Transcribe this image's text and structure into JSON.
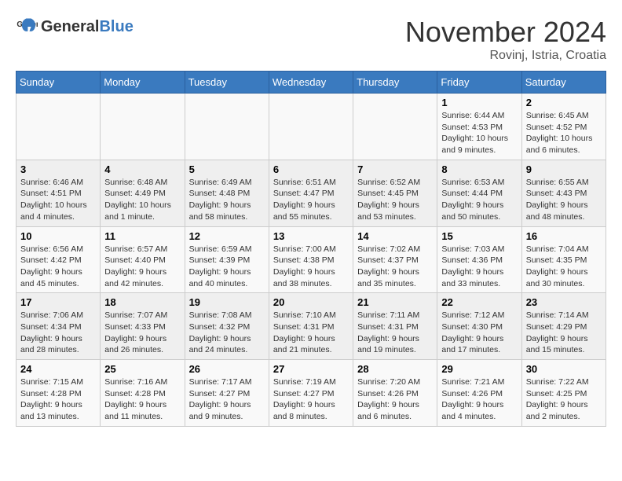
{
  "header": {
    "logo_general": "General",
    "logo_blue": "Blue",
    "month_year": "November 2024",
    "location": "Rovinj, Istria, Croatia"
  },
  "weekdays": [
    "Sunday",
    "Monday",
    "Tuesday",
    "Wednesday",
    "Thursday",
    "Friday",
    "Saturday"
  ],
  "weeks": [
    [
      {
        "day": "",
        "info": ""
      },
      {
        "day": "",
        "info": ""
      },
      {
        "day": "",
        "info": ""
      },
      {
        "day": "",
        "info": ""
      },
      {
        "day": "",
        "info": ""
      },
      {
        "day": "1",
        "info": "Sunrise: 6:44 AM\nSunset: 4:53 PM\nDaylight: 10 hours and 9 minutes."
      },
      {
        "day": "2",
        "info": "Sunrise: 6:45 AM\nSunset: 4:52 PM\nDaylight: 10 hours and 6 minutes."
      }
    ],
    [
      {
        "day": "3",
        "info": "Sunrise: 6:46 AM\nSunset: 4:51 PM\nDaylight: 10 hours and 4 minutes."
      },
      {
        "day": "4",
        "info": "Sunrise: 6:48 AM\nSunset: 4:49 PM\nDaylight: 10 hours and 1 minute."
      },
      {
        "day": "5",
        "info": "Sunrise: 6:49 AM\nSunset: 4:48 PM\nDaylight: 9 hours and 58 minutes."
      },
      {
        "day": "6",
        "info": "Sunrise: 6:51 AM\nSunset: 4:47 PM\nDaylight: 9 hours and 55 minutes."
      },
      {
        "day": "7",
        "info": "Sunrise: 6:52 AM\nSunset: 4:45 PM\nDaylight: 9 hours and 53 minutes."
      },
      {
        "day": "8",
        "info": "Sunrise: 6:53 AM\nSunset: 4:44 PM\nDaylight: 9 hours and 50 minutes."
      },
      {
        "day": "9",
        "info": "Sunrise: 6:55 AM\nSunset: 4:43 PM\nDaylight: 9 hours and 48 minutes."
      }
    ],
    [
      {
        "day": "10",
        "info": "Sunrise: 6:56 AM\nSunset: 4:42 PM\nDaylight: 9 hours and 45 minutes."
      },
      {
        "day": "11",
        "info": "Sunrise: 6:57 AM\nSunset: 4:40 PM\nDaylight: 9 hours and 42 minutes."
      },
      {
        "day": "12",
        "info": "Sunrise: 6:59 AM\nSunset: 4:39 PM\nDaylight: 9 hours and 40 minutes."
      },
      {
        "day": "13",
        "info": "Sunrise: 7:00 AM\nSunset: 4:38 PM\nDaylight: 9 hours and 38 minutes."
      },
      {
        "day": "14",
        "info": "Sunrise: 7:02 AM\nSunset: 4:37 PM\nDaylight: 9 hours and 35 minutes."
      },
      {
        "day": "15",
        "info": "Sunrise: 7:03 AM\nSunset: 4:36 PM\nDaylight: 9 hours and 33 minutes."
      },
      {
        "day": "16",
        "info": "Sunrise: 7:04 AM\nSunset: 4:35 PM\nDaylight: 9 hours and 30 minutes."
      }
    ],
    [
      {
        "day": "17",
        "info": "Sunrise: 7:06 AM\nSunset: 4:34 PM\nDaylight: 9 hours and 28 minutes."
      },
      {
        "day": "18",
        "info": "Sunrise: 7:07 AM\nSunset: 4:33 PM\nDaylight: 9 hours and 26 minutes."
      },
      {
        "day": "19",
        "info": "Sunrise: 7:08 AM\nSunset: 4:32 PM\nDaylight: 9 hours and 24 minutes."
      },
      {
        "day": "20",
        "info": "Sunrise: 7:10 AM\nSunset: 4:31 PM\nDaylight: 9 hours and 21 minutes."
      },
      {
        "day": "21",
        "info": "Sunrise: 7:11 AM\nSunset: 4:31 PM\nDaylight: 9 hours and 19 minutes."
      },
      {
        "day": "22",
        "info": "Sunrise: 7:12 AM\nSunset: 4:30 PM\nDaylight: 9 hours and 17 minutes."
      },
      {
        "day": "23",
        "info": "Sunrise: 7:14 AM\nSunset: 4:29 PM\nDaylight: 9 hours and 15 minutes."
      }
    ],
    [
      {
        "day": "24",
        "info": "Sunrise: 7:15 AM\nSunset: 4:28 PM\nDaylight: 9 hours and 13 minutes."
      },
      {
        "day": "25",
        "info": "Sunrise: 7:16 AM\nSunset: 4:28 PM\nDaylight: 9 hours and 11 minutes."
      },
      {
        "day": "26",
        "info": "Sunrise: 7:17 AM\nSunset: 4:27 PM\nDaylight: 9 hours and 9 minutes."
      },
      {
        "day": "27",
        "info": "Sunrise: 7:19 AM\nSunset: 4:27 PM\nDaylight: 9 hours and 8 minutes."
      },
      {
        "day": "28",
        "info": "Sunrise: 7:20 AM\nSunset: 4:26 PM\nDaylight: 9 hours and 6 minutes."
      },
      {
        "day": "29",
        "info": "Sunrise: 7:21 AM\nSunset: 4:26 PM\nDaylight: 9 hours and 4 minutes."
      },
      {
        "day": "30",
        "info": "Sunrise: 7:22 AM\nSunset: 4:25 PM\nDaylight: 9 hours and 2 minutes."
      }
    ]
  ]
}
